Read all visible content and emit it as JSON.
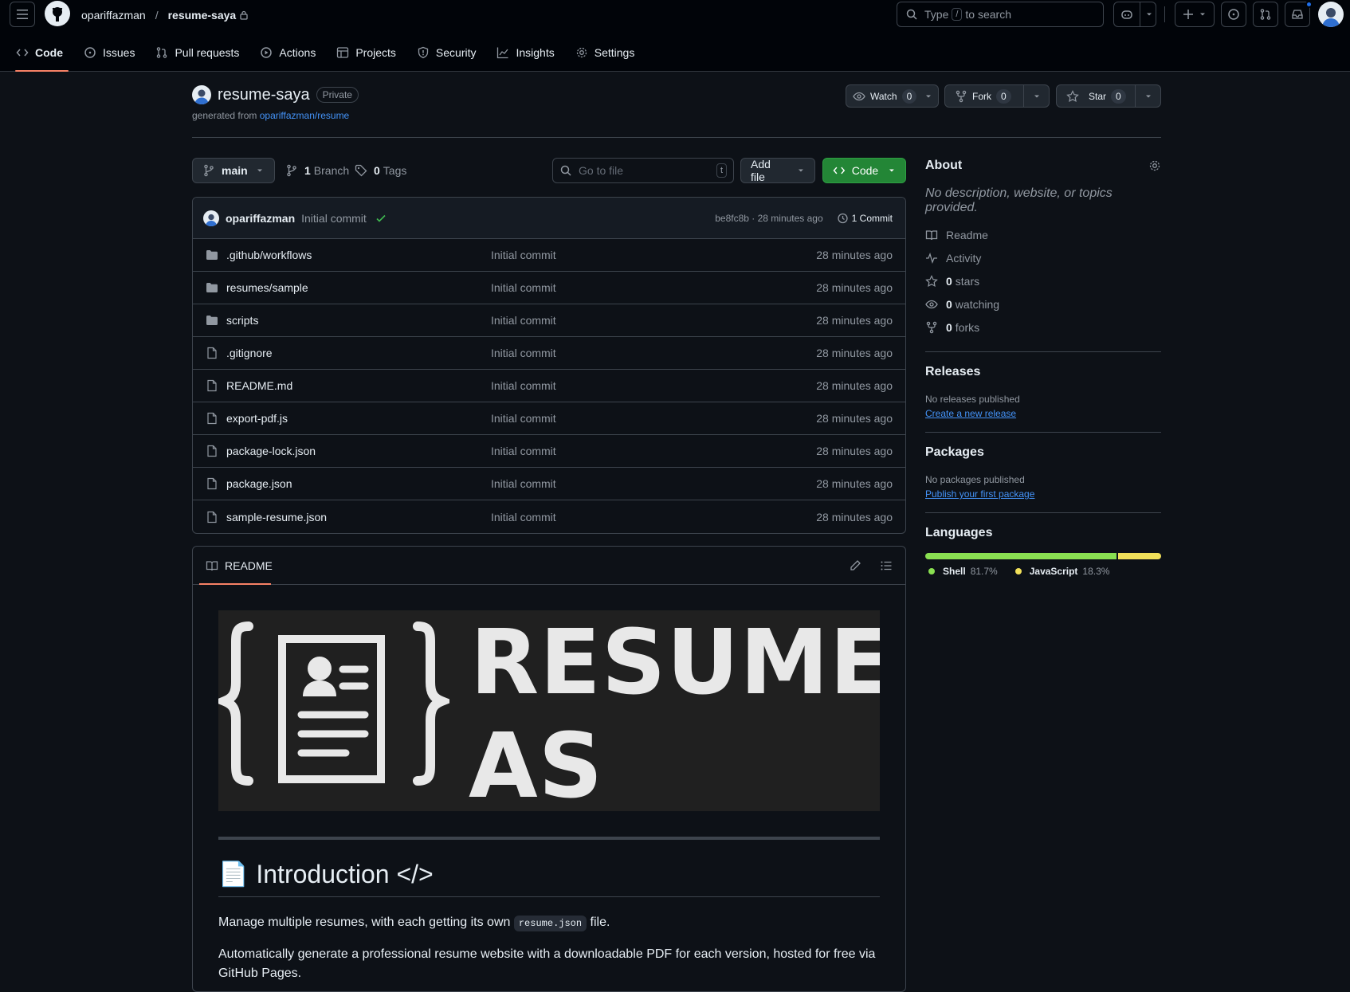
{
  "header": {
    "owner": "opariffazman",
    "repo": "resume-saya",
    "search_pre": "Type",
    "search_key": "/",
    "search_post": "to search"
  },
  "tabs": [
    "Code",
    "Issues",
    "Pull requests",
    "Actions",
    "Projects",
    "Security",
    "Insights",
    "Settings"
  ],
  "repo": {
    "name": "resume-saya",
    "visibility": "Private",
    "generated_prefix": "generated from",
    "generated_link": "opariffazman/resume",
    "watch": {
      "label": "Watch",
      "count": "0"
    },
    "fork": {
      "label": "Fork",
      "count": "0"
    },
    "star": {
      "label": "Star",
      "count": "0"
    }
  },
  "filenav": {
    "branch": "main",
    "branch_count": "1",
    "branch_label": "Branch",
    "tag_count": "0",
    "tag_label": "Tags",
    "goto_placeholder": "Go to file",
    "goto_key": "t",
    "add_file": "Add file",
    "code": "Code"
  },
  "commit": {
    "author": "opariffazman",
    "message": "Initial commit",
    "sha_time": "be8fc8b · 28 minutes ago",
    "count": "1 Commit"
  },
  "files": [
    {
      "name": ".github/workflows",
      "type": "dir",
      "msg": "Initial commit",
      "age": "28 minutes ago"
    },
    {
      "name": "resumes/sample",
      "type": "dir",
      "msg": "Initial commit",
      "age": "28 minutes ago"
    },
    {
      "name": "scripts",
      "type": "dir",
      "msg": "Initial commit",
      "age": "28 minutes ago"
    },
    {
      "name": ".gitignore",
      "type": "file",
      "msg": "Initial commit",
      "age": "28 minutes ago"
    },
    {
      "name": "README.md",
      "type": "file",
      "msg": "Initial commit",
      "age": "28 minutes ago"
    },
    {
      "name": "export-pdf.js",
      "type": "file",
      "msg": "Initial commit",
      "age": "28 minutes ago"
    },
    {
      "name": "package-lock.json",
      "type": "file",
      "msg": "Initial commit",
      "age": "28 minutes ago"
    },
    {
      "name": "package.json",
      "type": "file",
      "msg": "Initial commit",
      "age": "28 minutes ago"
    },
    {
      "name": "sample-resume.json",
      "type": "file",
      "msg": "Initial commit",
      "age": "28 minutes ago"
    }
  ],
  "readme": {
    "tab": "README",
    "banner_line1": "RESUME",
    "banner_line2": "AS CODE",
    "heading_emoji": "📄",
    "heading": "Introduction </>",
    "p1_pre": "Manage multiple resumes, with each getting its own",
    "p1_code": "resume.json",
    "p1_post": "file.",
    "p2": "Automatically generate a professional resume website with a downloadable PDF for each version, hosted for free via GitHub Pages."
  },
  "about": {
    "title": "About",
    "description": "No description, website, or topics provided.",
    "readme": "Readme",
    "activity": "Activity",
    "stars_n": "0",
    "stars_l": "stars",
    "watching_n": "0",
    "watching_l": "watching",
    "forks_n": "0",
    "forks_l": "forks"
  },
  "releases": {
    "title": "Releases",
    "none": "No releases published",
    "link": "Create a new release"
  },
  "packages": {
    "title": "Packages",
    "none": "No packages published",
    "link": "Publish your first package"
  },
  "languages": {
    "title": "Languages",
    "items": [
      {
        "name": "Shell",
        "pct": "81.7%",
        "value": 81.7,
        "color": "#89e051"
      },
      {
        "name": "JavaScript",
        "pct": "18.3%",
        "value": 18.3,
        "color": "#f1e05a"
      }
    ]
  },
  "colors": {
    "accent": "#f78166",
    "primary_btn": "#238636",
    "link": "#4493f8"
  }
}
